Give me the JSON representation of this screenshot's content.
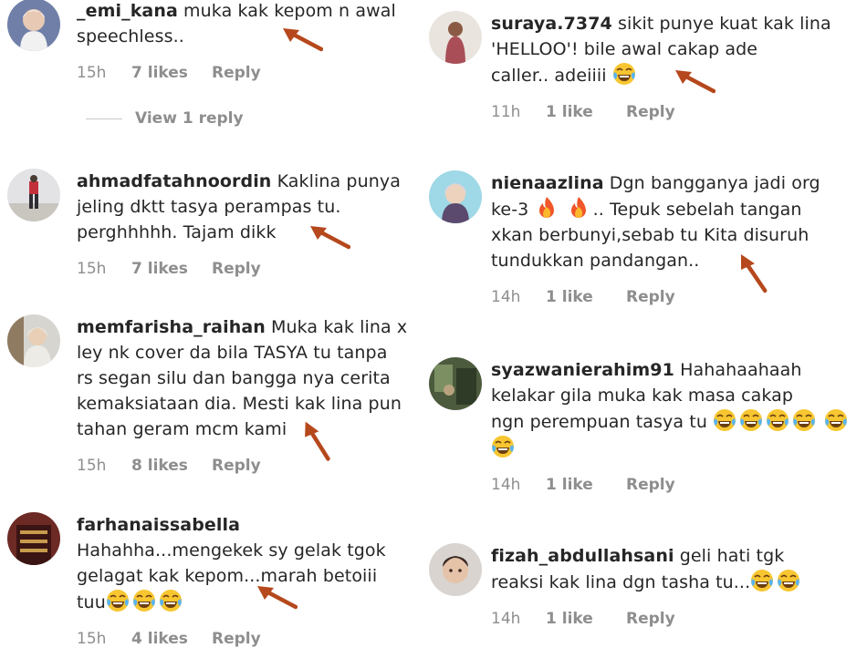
{
  "left_comments": [
    {
      "username": "_emi_kana",
      "text": "muka kak kepom n awal\nspeechless..",
      "time": "15h",
      "likes": "7 likes",
      "reply": "Reply",
      "view_replies": "View 1 reply"
    },
    {
      "username": "ahmadfatahnoordin",
      "text": "Kaklina punya\njeling dktt tasya perampas tu.\nperghhhhh. Tajam dikk",
      "time": "15h",
      "likes": "7 likes",
      "reply": "Reply"
    },
    {
      "username": "memfarisha_raihan",
      "text": "Muka kak lina x\nley nk cover da bila TASYA tu tanpa\nrs segan silu dan bangga nya cerita\nkemaksiataan dia. Mesti kak lina pun\ntahan geram mcm kami",
      "time": "15h",
      "likes": "8 likes",
      "reply": "Reply"
    },
    {
      "username": "farhanaissabella",
      "text": "\nHahahha...mengekek sy gelak tgok\ngelagat kak kepom...marah betoiii\ntuu",
      "time": "15h",
      "likes": "4 likes",
      "reply": "Reply"
    }
  ],
  "right_comments": [
    {
      "username": "suraya.7374",
      "text": "sikit punye kuat kak lina\n'HELLOO'! bile awal cakap ade\ncaller.. adeiiii",
      "time": "11h",
      "likes": "1 like",
      "reply": "Reply"
    },
    {
      "username": "nienaazlina",
      "text": "Dgn bangganya jadi org\nke-3",
      "text_after_emoji": ".. Tepuk sebelah tangan\nxkan berbunyi,sebab tu Kita disuruh\ntundukkan pandangan..",
      "time": "14h",
      "likes": "1 like",
      "reply": "Reply"
    },
    {
      "username": "syazwanierahim91",
      "text": "Hahahaahaah\nkelakar gila muka kak masa cakap\nngn perempuan tasya tu",
      "time": "14h",
      "likes": "1 like",
      "reply": "Reply"
    },
    {
      "username": "fizah_abdullahsani",
      "text": "geli hati tgk\nreaksi kak lina dgn tasha tu...",
      "time": "14h",
      "likes": "1 like",
      "reply": "Reply"
    }
  ],
  "colors": {
    "text": "#262626",
    "meta": "#8e8e8e",
    "arrow": "#b5481c"
  },
  "icons": [
    "laughing-emoji",
    "fire-emoji",
    "annotation-arrow"
  ]
}
